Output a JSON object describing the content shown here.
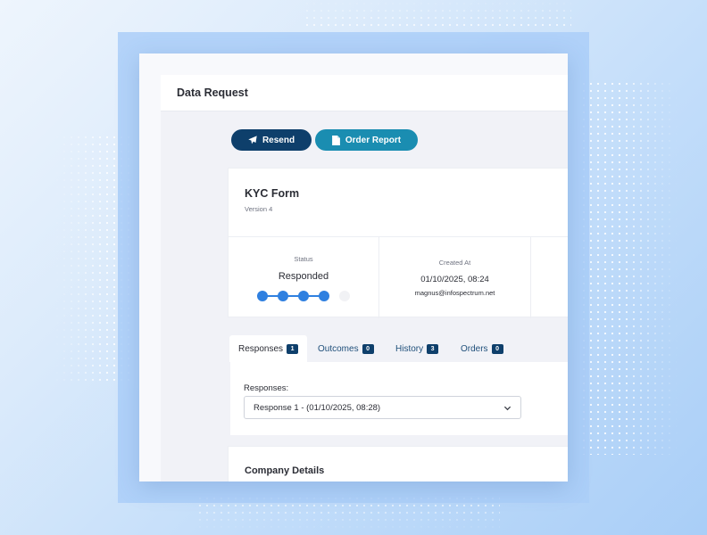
{
  "header": {
    "title": "Data Request"
  },
  "actions": {
    "resend_label": "Resend",
    "order_report_label": "Order Report",
    "resend_icon": "paper-plane-icon",
    "order_report_icon": "document-icon"
  },
  "form": {
    "title": "KYC Form",
    "version": "Version 4",
    "status_label": "Status",
    "status_value": "Responded",
    "status_steps_total": 5,
    "status_steps_completed": 4,
    "created_label": "Created At",
    "created_value": "01/10/2025, 08:24",
    "created_by": "magnus@infospectrum.net"
  },
  "tabs": [
    {
      "label": "Responses",
      "count": "1",
      "active": true
    },
    {
      "label": "Outcomes",
      "count": "0",
      "active": false
    },
    {
      "label": "History",
      "count": "3",
      "active": false
    },
    {
      "label": "Orders",
      "count": "0",
      "active": false
    }
  ],
  "responses": {
    "label": "Responses:",
    "selected": "Response 1 - (01/10/2025, 08:28)"
  },
  "section": {
    "title": "Company Details"
  },
  "colors": {
    "primary_dark": "#0e3f6b",
    "primary_teal": "#1a8db1",
    "step_blue": "#2f80e0",
    "background_blue": "#a9cef7"
  }
}
